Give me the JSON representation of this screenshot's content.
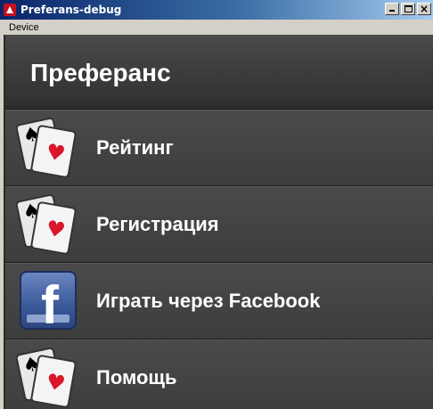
{
  "window": {
    "title": "Preferans-debug",
    "menu": [
      "Device"
    ]
  },
  "app": {
    "header_title": "Преферанс",
    "items": [
      {
        "label": "Рейтинг",
        "icon": "playing-cards-icon"
      },
      {
        "label": "Регистрация",
        "icon": "playing-cards-icon"
      },
      {
        "label": "Играть через Facebook",
        "icon": "facebook-icon"
      },
      {
        "label": "Помощь",
        "icon": "playing-cards-icon"
      }
    ]
  },
  "colors": {
    "background": "#3a3a3a",
    "text": "#ffffff",
    "heart": "#d9162a",
    "facebook": "#3b5998"
  }
}
